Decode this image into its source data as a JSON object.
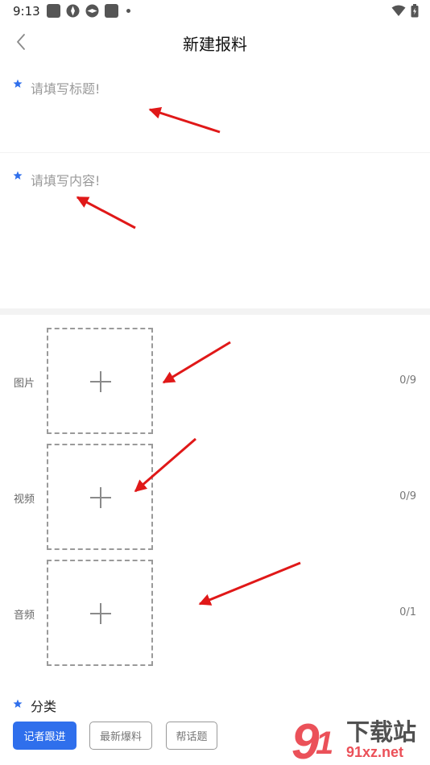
{
  "status_bar": {
    "time": "9:13"
  },
  "nav": {
    "title": "新建报料",
    "back_icon": "chevron-left-icon"
  },
  "form": {
    "title_placeholder": "请填写标题!",
    "content_placeholder": "请填写内容!"
  },
  "media": [
    {
      "label": "图片",
      "count": "0/9"
    },
    {
      "label": "视频",
      "count": "0/9"
    },
    {
      "label": "音频",
      "count": "0/1"
    }
  ],
  "category": {
    "title": "分类",
    "chips": [
      "记者跟进",
      "最新爆料",
      "帮话题"
    ]
  },
  "watermark": {
    "brand": "下载站",
    "domain": "91xz.net"
  },
  "colors": {
    "accent": "#2f6fec",
    "annotation_arrow": "#e01818",
    "watermark_red": "#e8323c"
  }
}
